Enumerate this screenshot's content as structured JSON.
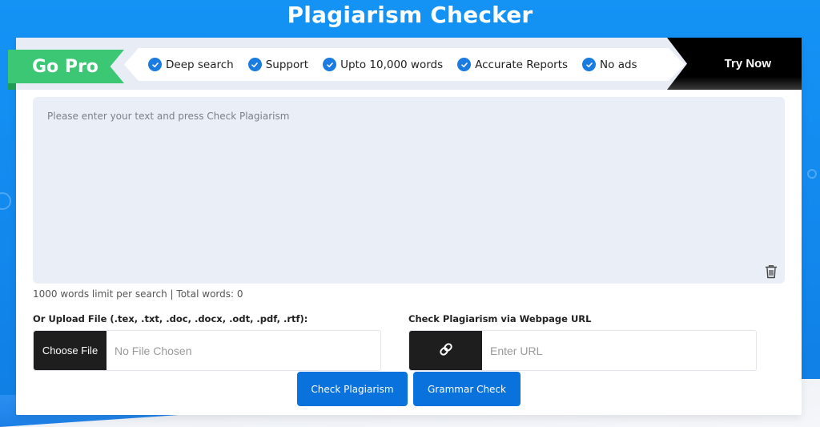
{
  "page": {
    "title": "Plagiarism Checker"
  },
  "promo": {
    "go_pro_label": "Go Pro",
    "features": [
      {
        "label": "Deep search",
        "icon": "check-circle-icon"
      },
      {
        "label": "Support",
        "icon": "check-circle-icon"
      },
      {
        "label": "Upto 10,000 words",
        "icon": "check-circle-icon"
      },
      {
        "label": "Accurate Reports",
        "icon": "check-circle-icon"
      },
      {
        "label": "No ads",
        "icon": "check-circle-icon"
      }
    ],
    "try_now_label": "Try Now"
  },
  "editor": {
    "placeholder": "Please enter your text and press Check Plagiarism",
    "value": "",
    "clear_icon": "trash-icon",
    "words_info": "1000 words limit per search | Total words: 0"
  },
  "upload": {
    "label": "Or Upload File (.tex, .txt, .doc, .docx, .odt, .pdf, .rtf):",
    "button_label": "Choose File",
    "status": "No File Chosen"
  },
  "url_check": {
    "label": "Check Plagiarism via Webpage URL",
    "icon": "link-icon",
    "placeholder": "Enter URL",
    "value": ""
  },
  "actions": {
    "check_plagiarism_label": "Check Plagiarism",
    "grammar_check_label": "Grammar Check"
  },
  "colors": {
    "brand_blue": "#1493f5",
    "button_blue": "#0a72dc",
    "go_pro_green": "#3cc774",
    "try_now_black": "#000000",
    "editor_bg": "#eaeff7"
  }
}
